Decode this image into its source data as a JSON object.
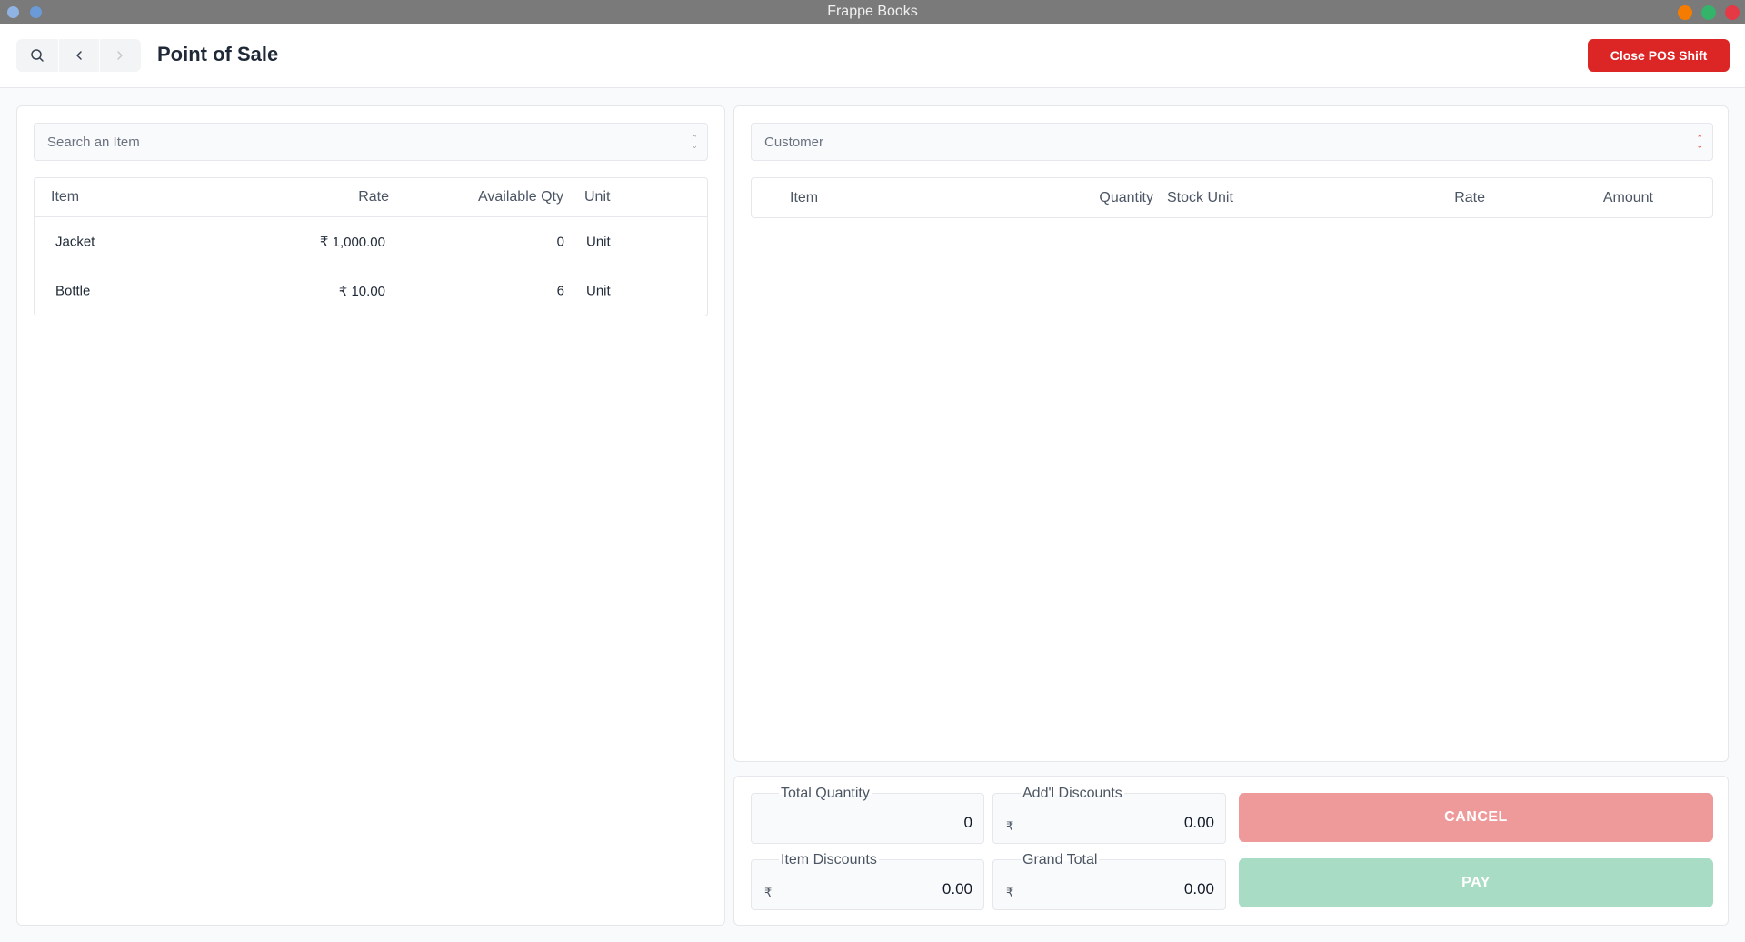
{
  "window": {
    "title": "Frappe Books"
  },
  "header": {
    "title": "Point of Sale",
    "close_shift_label": "Close POS Shift"
  },
  "item_panel": {
    "search_placeholder": "Search an Item",
    "columns": {
      "item": "Item",
      "rate": "Rate",
      "available_qty": "Available Qty",
      "unit": "Unit"
    },
    "rows": [
      {
        "item": "Jacket",
        "rate": "₹ 1,000.00",
        "available_qty": "0",
        "unit": "Unit"
      },
      {
        "item": "Bottle",
        "rate": "₹ 10.00",
        "available_qty": "6",
        "unit": "Unit"
      }
    ]
  },
  "cart_panel": {
    "customer_placeholder": "Customer",
    "columns": {
      "item": "Item",
      "quantity": "Quantity",
      "stock_unit": "Stock Unit",
      "rate": "Rate",
      "amount": "Amount"
    }
  },
  "summary": {
    "total_quantity_label": "Total Quantity",
    "total_quantity_value": "0",
    "addl_discounts_label": "Add'l Discounts",
    "addl_discounts_value": "0.00",
    "item_discounts_label": "Item Discounts",
    "item_discounts_value": "0.00",
    "grand_total_label": "Grand Total",
    "grand_total_value": "0.00",
    "currency_symbol": "₹",
    "cancel_label": "CANCEL",
    "pay_label": "PAY"
  },
  "colors": {
    "primary_red": "#dc2626",
    "cancel_bg": "#ef9a9a",
    "pay_bg": "#a8dcc4"
  }
}
